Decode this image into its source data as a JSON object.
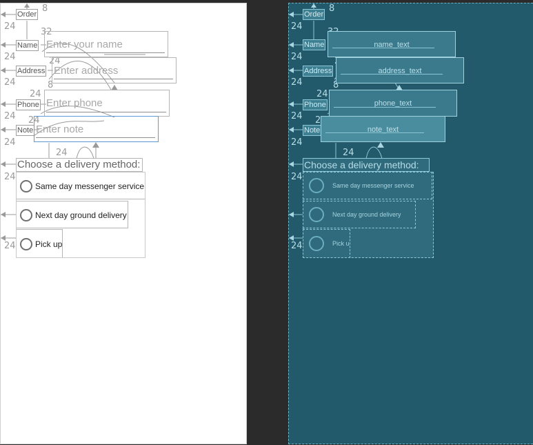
{
  "design": {
    "margins": {
      "top": "8",
      "side": "24",
      "name_gap": "32",
      "phone_gap": "8"
    },
    "fields": [
      {
        "id": "order",
        "label": "Order"
      },
      {
        "id": "name",
        "label": "Name",
        "hint": "Enter your name"
      },
      {
        "id": "address",
        "label": "Address",
        "hint": "Enter address"
      },
      {
        "id": "phone",
        "label": "Phone",
        "hint": "Enter phone"
      },
      {
        "id": "note",
        "label": "Note",
        "hint": "Enter note"
      }
    ],
    "heading": "Choose a delivery method:",
    "options": [
      "Same day messenger service",
      "Next day ground delivery",
      "Pick up"
    ]
  },
  "blueprint": {
    "margins": {
      "top": "8",
      "side": "24",
      "name_gap": "32",
      "phone_gap": "8"
    },
    "labels": [
      "Order",
      "Name",
      "Address",
      "Phone",
      "Note"
    ],
    "ids": [
      "name_text",
      "address_text",
      "phone_text",
      "note_text"
    ],
    "heading": "Choose a delivery method:",
    "options": [
      "Same day messenger service",
      "Next day ground delivery",
      "Pick up"
    ]
  },
  "colors": {
    "blueprint_bg": "#225a6b",
    "design_bg": "#ffffff",
    "selection": "#5c9bd6",
    "dark_bg": "#2b2b2b"
  },
  "icons": [
    "radio-button-icon",
    "constraint-arrow-icon"
  ]
}
